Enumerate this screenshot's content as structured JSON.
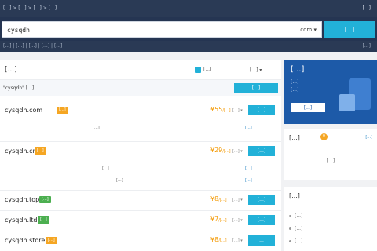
{
  "top": {
    "breadcrumb": "[...] > [...] > [...] > [...]",
    "right_link": "[...]"
  },
  "search": {
    "value": "cysqdh",
    "tld": ".com ▾",
    "button_label": "[...]"
  },
  "subnav": {
    "links": "[...] | [...] | [...] | [...] | [...]",
    "right": "[...]"
  },
  "results": {
    "title": "[...]",
    "filter_label": "[...]",
    "filter_select": "[...] ▾",
    "notice": "\"cysqdh\" [...]",
    "batch_button": "[...]",
    "rows": [
      {
        "domain": "cysqdh.com",
        "tag": "[...]",
        "price": "¥55",
        "unit": "/[...]",
        "more": "[...] ▾",
        "button": "[...]"
      },
      {
        "domain": "cysqdh.cn",
        "tag": "[...]",
        "price": "¥29",
        "unit": "/[...]",
        "more": "[...] ▾",
        "button": "[...]"
      },
      {
        "domain": "cysqdh.top",
        "tag": "[...]",
        "price": "¥8",
        "unit": "/[...]",
        "more": "[...] ▾",
        "button": "[...]"
      },
      {
        "domain": "cysqdh.ltd",
        "tag": "[...]",
        "price": "¥7",
        "unit": "/[...]",
        "more": "[...] ▾",
        "button": "[...]"
      },
      {
        "domain": "cysqdh.store",
        "tag": "[...]",
        "price": "¥8",
        "unit": "/[...]",
        "more": "[...] ▾",
        "button": "[...]"
      }
    ],
    "suggest_com": "[...]",
    "suggest_com_link": "[...]",
    "suggest_cn_1": "[...]",
    "suggest_cn_2": "[...]",
    "suggest_cn_link1": "[...]",
    "suggest_cn_link2": "[...]"
  },
  "promo": {
    "title": "[...]",
    "line1": "[...]",
    "line2": "[...]",
    "button": "[...]"
  },
  "cart": {
    "title": "[...]",
    "count": "0",
    "action": "[...]",
    "empty": "[...]"
  },
  "knowledge": {
    "title": "[...]",
    "items": [
      "[...]",
      "[...]",
      "[...]"
    ]
  },
  "colors": {
    "accent": "#22b1d8",
    "header": "#2a3a55",
    "price": "#f39800",
    "promo": "#1d5aa8"
  }
}
